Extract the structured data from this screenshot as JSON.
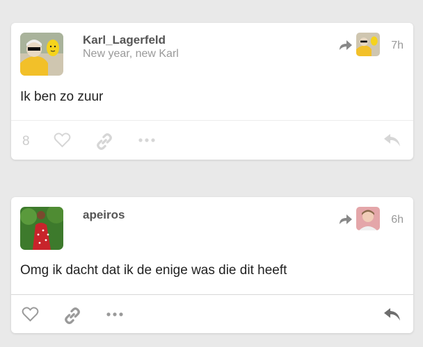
{
  "posts": [
    {
      "username": "Karl_Lagerfeld",
      "subtitle": "New year, new Karl",
      "time": "7h",
      "body": "Ik ben zo zuur",
      "notes": "8",
      "icons": [
        "avatar",
        "reblog-icon",
        "heart-icon",
        "link-icon",
        "more-icon",
        "reply-icon"
      ],
      "colors": {
        "action": "#d6d6d6",
        "avatar_bg": "#f2c029"
      }
    },
    {
      "username": "apeiros",
      "subtitle": "",
      "time": "6h",
      "body": "Omg ik dacht dat ik de enige was die dit heeft",
      "icons": [
        "avatar",
        "reblog-icon",
        "heart-icon",
        "link-icon",
        "more-icon",
        "reply-icon"
      ],
      "colors": {
        "action": "#9a9a9a",
        "avatar_bg": "#3d7a2c"
      }
    }
  ]
}
